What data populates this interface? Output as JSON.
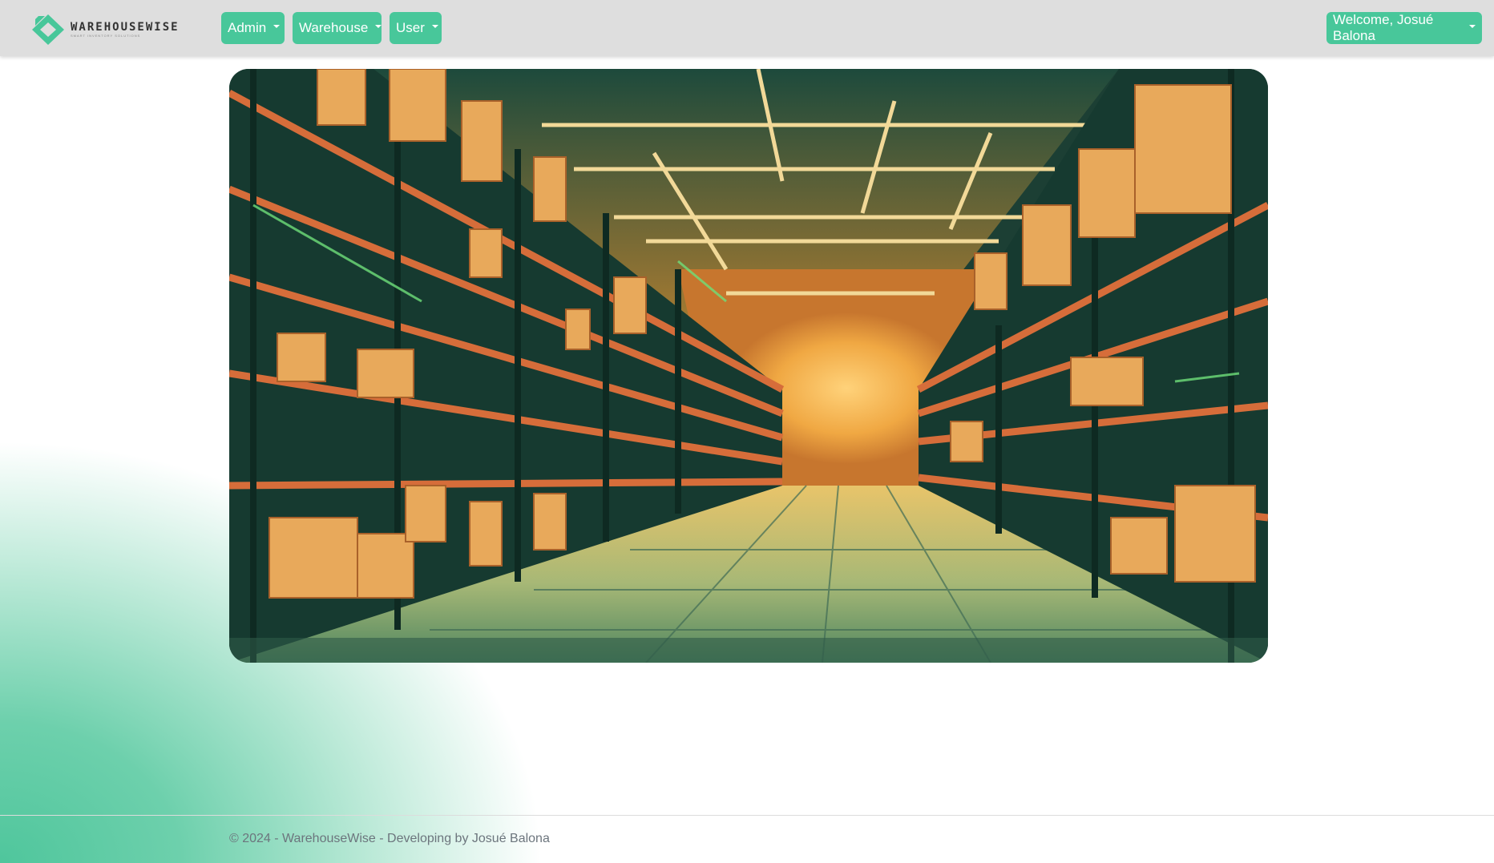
{
  "brand": {
    "name": "WAREHOUSEWISE",
    "tagline": "SMART INVENTORY SOLUTIONS",
    "logo_icon": "diamond-logo-icon",
    "accent_color": "#48c79a"
  },
  "nav": {
    "admin_label": "Admin",
    "warehouse_label": "Warehouse",
    "user_label": "User",
    "welcome_label": "Welcome, Josué Balona"
  },
  "hero": {
    "image_alt": "Illustration of warehouse aisle with shelves full of boxes"
  },
  "footer": {
    "text": "© 2024 - WarehouseWise - Developing by Josué Balona"
  }
}
